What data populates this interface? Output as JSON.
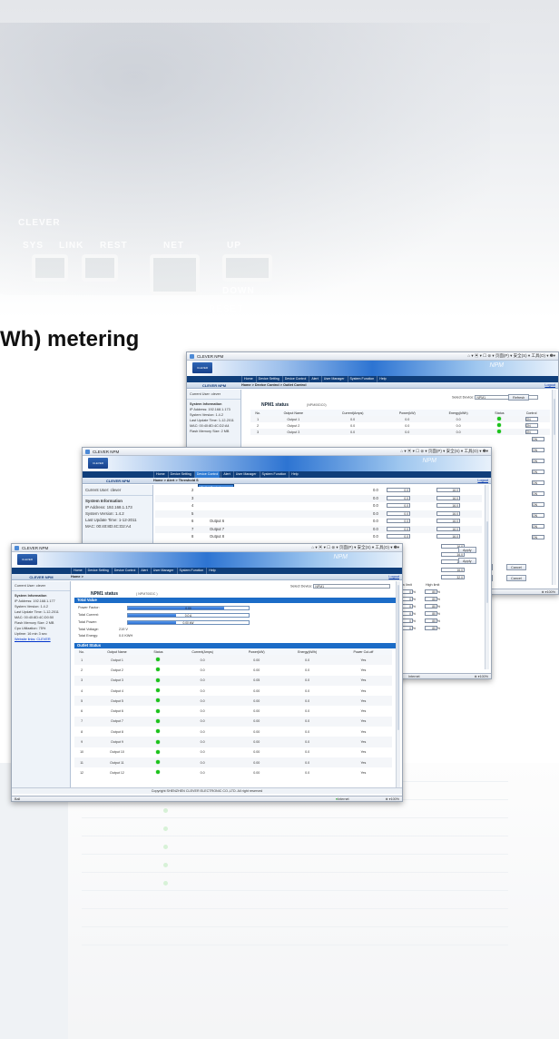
{
  "heading": "Wh) metering",
  "device": {
    "labels": [
      "CLEVER",
      "SYS",
      "LINK",
      "REST",
      "NET",
      "UP",
      "DOWN",
      "RESET"
    ]
  },
  "app": {
    "title": "CLEVER NPM",
    "banner": "NPM",
    "name": "CLEVER NPM",
    "logout": "Logout",
    "browser_tools": "⌂ ▾ ▣ ▾ ☐ ⊜ ▾ 页面(P) ▾ 安全(S) ▾ 工具(O) ▾ ❷▾",
    "menu": [
      "Home",
      "Device Setting",
      "Device Control",
      "Alert",
      "User Manager",
      "System Function",
      "Help"
    ],
    "current_user": "Current User: clever",
    "system_info_title": "System Information",
    "ip": "IP Address: 192.168.1.173",
    "version": "System Version: 1.4.2",
    "last_update": "Last Update Time: 1-12-2011",
    "mac": "MAC: 00:40:8D:4C:D2:A4",
    "flash": "Flash Memory Size: 2 MB"
  },
  "back": {
    "breadcrumb": "Home > Device Control > Outlet Control",
    "select_label": "Select Device:",
    "select_value": "NPM1",
    "refresh": "Refresh",
    "status_title": "NPM1 status",
    "status_sub": "(NPM00DC0)",
    "columns": [
      "No.",
      "Output Name",
      "Current(Amps)",
      "Power(kW)",
      "Energy(kWh)",
      "Status",
      "Control"
    ],
    "rows": [
      {
        "no": "1",
        "name": "Output 1",
        "cur": "0.0",
        "pw": "0.0",
        "en": "0.0",
        "ctl": "ON"
      },
      {
        "no": "2",
        "name": "Output 2",
        "cur": "0.0",
        "pw": "0.0",
        "en": "0.0",
        "ctl": "ON"
      },
      {
        "no": "3",
        "name": "Output 3",
        "cur": "0.0",
        "pw": "0.0",
        "en": "0.0",
        "ctl": "ON"
      }
    ],
    "right_ctls": [
      "ON",
      "ON",
      "ON",
      "ON",
      "ON",
      "ON",
      "ON",
      "ON",
      "ON",
      "ON"
    ],
    "apply": "Apply",
    "cancel": "Cancel",
    "zoom": "100%"
  },
  "middle": {
    "breadcrumb": "Home > Alert > Threshold S",
    "dropdown": [
      "Outlet Control",
      "Power Cut-off",
      "Energy Clear",
      "Timing",
      "Sensor"
    ],
    "rows": [
      {
        "no": "2",
        "name": "",
        "val": "0.0",
        "th": "16.0"
      },
      {
        "no": "3",
        "name": "",
        "val": "0.0",
        "th": "16.0"
      },
      {
        "no": "4",
        "name": "",
        "val": "0.0",
        "th": "16.0"
      },
      {
        "no": "5",
        "name": "",
        "val": "0.0",
        "th": "16.0"
      },
      {
        "no": "6",
        "name": "Output 6",
        "val": "0.0",
        "th": "16.0"
      },
      {
        "no": "7",
        "name": "Output 7",
        "val": "0.0",
        "th": "16.0"
      },
      {
        "no": "8",
        "name": "Output 8",
        "val": "0.0",
        "th": "16.0"
      }
    ],
    "extra_th": [
      "16.0",
      "16.0",
      "16.0",
      "16.0",
      "32.0"
    ],
    "low_limit": "Low limit",
    "high_limit": "High limit",
    "limits": [
      {
        "lo": "0",
        "hi": "80"
      },
      {
        "lo": "0",
        "hi": "80"
      },
      {
        "lo": "0",
        "hi": "80"
      },
      {
        "lo": "0",
        "hi": "80"
      },
      {
        "lo": "0",
        "hi": "80"
      },
      {
        "lo": "0",
        "hi": "80"
      }
    ],
    "pct": "%",
    "apply": "Apply",
    "cancel": "Cancel",
    "internet": "Internet",
    "zoom": "100%"
  },
  "front": {
    "breadcrumb": "Home >",
    "ip": "IP Address: 192.168.1.177",
    "version": "System Version: 1.4.2",
    "last_update": "Last Update Time: 1-12-2011",
    "mac": "MAC: 00:40:8D:4C:D0:50",
    "flash": "Flash Memory Size: 2 MB",
    "cpu": "Cpu Utilization: 75%",
    "uptime": "Uptime: 16 min 3 sec",
    "website": "Website links: CLEVER",
    "select_label": "Select Device:",
    "select_value": "NPM1",
    "status_title": "NPM1 status",
    "status_sub": "( NPM700DC )",
    "total_value": "Total Value",
    "power_factor_label": "Power Factor:",
    "power_factor_value": "0.00",
    "power_factor_fill": 0.8,
    "total_current_label": "Total Current:",
    "total_current_value": "0.0 A",
    "total_current_fill": 0.4,
    "total_power_label": "Total Power:",
    "total_power_value": "0.00 kW",
    "total_power_fill": 0.4,
    "total_voltage_label": "Total Voltage:",
    "total_voltage_value": "219 V",
    "total_energy_label": "Total Energy:",
    "total_energy_value": "0.0 KWH",
    "outlet_status": "Outlet Status",
    "columns": [
      "No.",
      "Output Name",
      "Status",
      "Current(Amps)",
      "Power(kW)",
      "Energy(kWh)",
      "Power Cut-off"
    ],
    "rows": [
      {
        "no": "1",
        "name": "Output 1",
        "cur": "0.0",
        "pw": "0.00",
        "en": "0.0",
        "cut": "Yes"
      },
      {
        "no": "2",
        "name": "Output 2",
        "cur": "0.0",
        "pw": "0.00",
        "en": "0.0",
        "cut": "Yes"
      },
      {
        "no": "3",
        "name": "Output 3",
        "cur": "0.0",
        "pw": "0.05",
        "en": "0.0",
        "cut": "Yes"
      },
      {
        "no": "4",
        "name": "Output 4",
        "cur": "0.0",
        "pw": "0.00",
        "en": "0.0",
        "cut": "Yes"
      },
      {
        "no": "5",
        "name": "Output 5",
        "cur": "0.0",
        "pw": "0.00",
        "en": "0.0",
        "cut": "Yes"
      },
      {
        "no": "6",
        "name": "Output 6",
        "cur": "0.0",
        "pw": "0.00",
        "en": "0.0",
        "cut": "Yes"
      },
      {
        "no": "7",
        "name": "Output 7",
        "cur": "0.0",
        "pw": "0.00",
        "en": "0.0",
        "cut": "Yes"
      },
      {
        "no": "8",
        "name": "Output 8",
        "cur": "0.0",
        "pw": "0.00",
        "en": "0.0",
        "cut": "Yes"
      },
      {
        "no": "9",
        "name": "Output 9",
        "cur": "0.0",
        "pw": "0.00",
        "en": "0.0",
        "cut": "Yes"
      },
      {
        "no": "10",
        "name": "Output 10",
        "cur": "0.0",
        "pw": "0.00",
        "en": "0.0",
        "cut": "Yes"
      },
      {
        "no": "11",
        "name": "Output 11",
        "cur": "0.0",
        "pw": "0.00",
        "en": "0.0",
        "cut": "Yes"
      },
      {
        "no": "12",
        "name": "Output 12",
        "cur": "0.0",
        "pw": "0.00",
        "en": "0.0",
        "cut": "Yes"
      }
    ],
    "copyright": "Copyright SHENZHEN CLEVER ELECTRONIC CO.,LTD. All right reserved",
    "status_left": "Ball",
    "internet": "Internet",
    "zoom": "100%"
  },
  "colors": {
    "accent": "#1c6cc7",
    "nav": "#0f3e7a",
    "status_on": "#1bc41b"
  }
}
